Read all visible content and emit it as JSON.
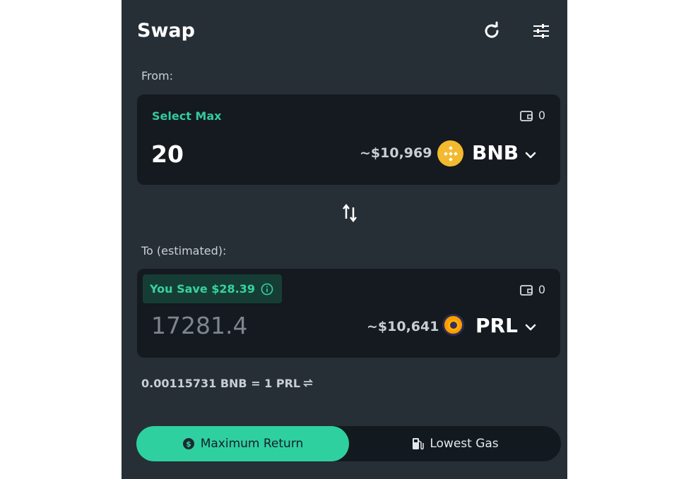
{
  "header": {
    "title": "Swap"
  },
  "from": {
    "label": "From:",
    "select_max": "Select Max",
    "wallet_balance": "0",
    "amount": "20",
    "usd_value": "~$10,969",
    "token": "BNB"
  },
  "to": {
    "label": "To (estimated):",
    "savings": "You Save $28.39",
    "wallet_balance": "0",
    "amount": "17281.4",
    "usd_value": "~$10,641",
    "token": "PRL"
  },
  "rate": {
    "text": "0.00115731 BNB = 1 PRL"
  },
  "route_options": {
    "max_return": "Maximum Return",
    "lowest_gas": "Lowest Gas",
    "selected": "Maximum Return"
  },
  "colors": {
    "accent": "#2fd0a0",
    "panel": "#262f36",
    "card": "#141a1f",
    "bnb": "#f3ba2f"
  },
  "icons": [
    "refresh-icon",
    "settings-sliders-icon",
    "wallet-icon",
    "bnb-token-icon",
    "prl-token-icon",
    "chevron-down-icon",
    "swap-direction-icon",
    "info-icon",
    "swap-rate-icon",
    "dollar-circle-icon",
    "gas-pump-icon"
  ]
}
